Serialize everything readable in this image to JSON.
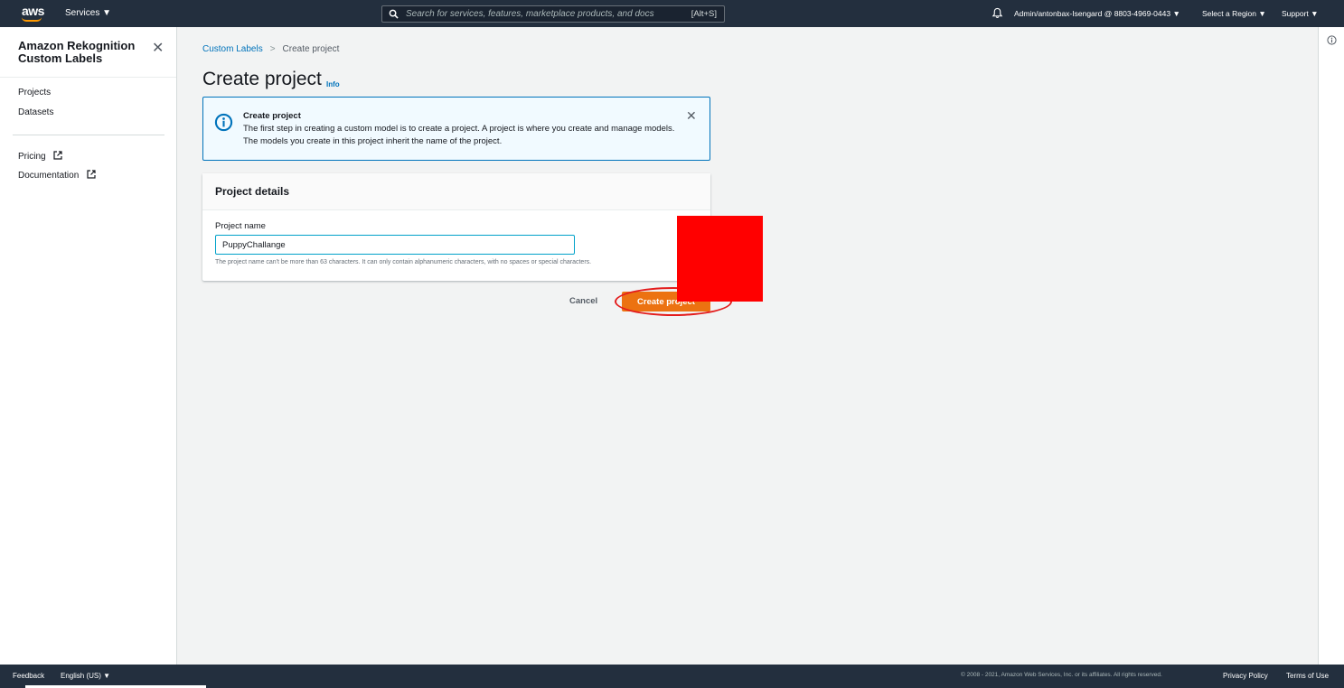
{
  "topnav": {
    "logo": "aws",
    "services_label": "Services ▼",
    "search_placeholder": "Search for services, features, marketplace products, and docs",
    "search_shortcut": "[Alt+S]",
    "account_label": "Admin/antonbax-Isengard @ 8803-4969-0443 ▼",
    "region_label": "Select a Region ▼",
    "support_label": "Support ▼",
    "icons": [
      "search-icon",
      "bell-icon"
    ]
  },
  "sidenav": {
    "title": "Amazon Rekognition Custom Labels",
    "close_glyph": "✕",
    "items": [
      {
        "label": "Projects"
      },
      {
        "label": "Datasets"
      }
    ],
    "external_links": [
      {
        "label": "Pricing",
        "icon": "external-link-icon"
      },
      {
        "label": "Documentation",
        "icon": "external-link-icon"
      }
    ]
  },
  "breadcrumb": {
    "parent": "Custom Labels",
    "separator": ">",
    "current": "Create project"
  },
  "page": {
    "title": "Create project",
    "info_link": "Info"
  },
  "flash": {
    "icon": "info-circle-icon",
    "title": "Create project",
    "message": "The first step in creating a custom model is to create a project. A project is where you create and manage models. The models you create in this project inherit the name of the project.",
    "close_glyph": "✕"
  },
  "project_details": {
    "header": "Project details",
    "field_label": "Project name",
    "field_value": "PuppyChallange",
    "field_hint": "The project name can't be more than 63 characters. It can only contain alphanumeric characters, with no spaces or special characters."
  },
  "actions": {
    "cancel_label": "Cancel",
    "create_label": "Create project"
  },
  "footer": {
    "feedback": "Feedback",
    "language": "English (US) ▼",
    "copyright": "© 2008 - 2021, Amazon Web Services, Inc. or its affiliates. All rights reserved.",
    "privacy": "Privacy Policy",
    "terms": "Terms of Use"
  },
  "colors": {
    "nav_bg": "#232f3e",
    "primary_button": "#ec7211",
    "link": "#0073bb",
    "annotation_red": "#ff0000"
  }
}
